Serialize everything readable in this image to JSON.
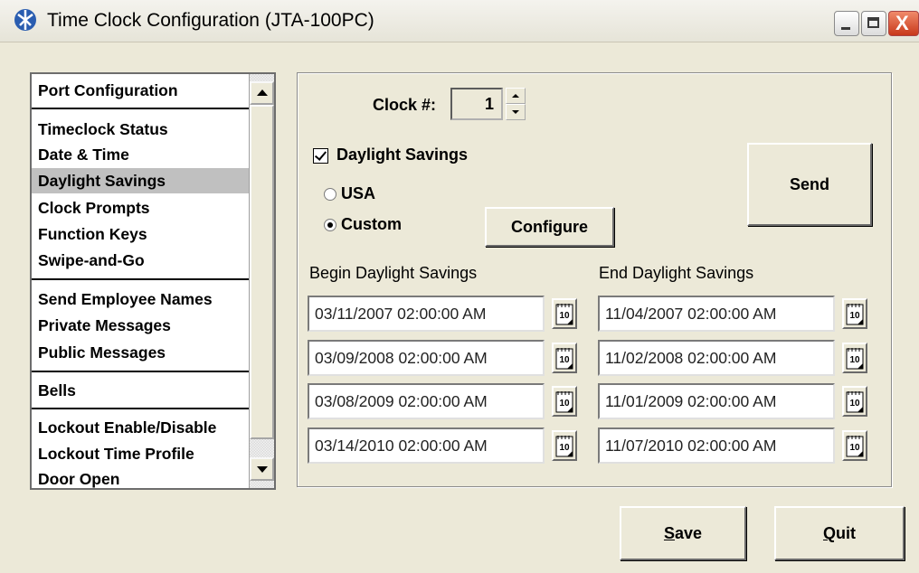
{
  "window": {
    "title": "Time Clock Configuration (JTA-100PC)",
    "controls": [
      "minimize-icon",
      "maximize-icon",
      "close-icon"
    ],
    "close_glyph": "X"
  },
  "nav": {
    "items": [
      {
        "label": "Port Configuration"
      },
      {
        "label": "Timeclock Status"
      },
      {
        "label": "Date & Time"
      },
      {
        "label": "Daylight Savings",
        "selected": true
      },
      {
        "label": "Clock Prompts"
      },
      {
        "label": "Function Keys"
      },
      {
        "label": "Swipe-and-Go"
      },
      {
        "label": "Send Employee Names"
      },
      {
        "label": "Private Messages"
      },
      {
        "label": "Public Messages"
      },
      {
        "label": "Bells"
      },
      {
        "label": "Lockout Enable/Disable"
      },
      {
        "label": "Lockout Time Profile"
      },
      {
        "label": "Door Open"
      }
    ]
  },
  "clock": {
    "label": "Clock #:",
    "value": "1"
  },
  "daylight": {
    "checkbox_label": "Daylight Savings",
    "checked": true,
    "options": [
      {
        "label": "USA",
        "selected": false
      },
      {
        "label": "Custom",
        "selected": true
      }
    ],
    "configure_label": "Configure",
    "send_label": "Send",
    "begin_header": "Begin Daylight Savings",
    "end_header": "End Daylight Savings",
    "rows": [
      {
        "begin": "03/11/2007 02:00:00 AM",
        "end": "11/04/2007 02:00:00 AM"
      },
      {
        "begin": "03/09/2008 02:00:00 AM",
        "end": "11/02/2008 02:00:00 AM"
      },
      {
        "begin": "03/08/2009 02:00:00 AM",
        "end": "11/01/2009 02:00:00 AM"
      },
      {
        "begin": "03/14/2010 02:00:00 AM",
        "end": "11/07/2010 02:00:00 AM"
      }
    ],
    "calendar_icon_text": "10"
  },
  "footer": {
    "save_label": "Save",
    "save_mnemonic": "S",
    "save_rest": "ave",
    "quit_label": "Quit",
    "quit_mnemonic": "Q",
    "quit_rest": "uit"
  }
}
